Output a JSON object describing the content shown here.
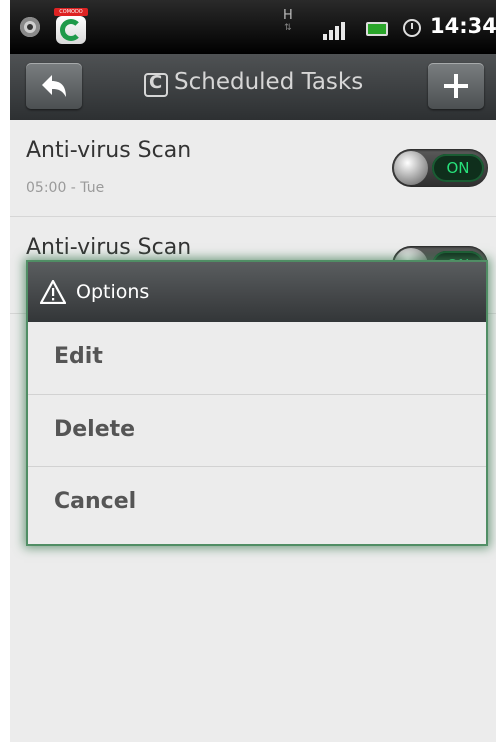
{
  "status_bar": {
    "app_badge": "COMODO",
    "network_label": "H",
    "time": "14:34"
  },
  "title_bar": {
    "title": "Scheduled Tasks"
  },
  "tasks": [
    {
      "title": "Anti-virus Scan",
      "schedule": "05:00 - Tue",
      "toggle": "ON"
    },
    {
      "title": "Anti-virus Scan",
      "schedule": "",
      "toggle": "ON"
    }
  ],
  "dialog": {
    "title": "Options",
    "items": [
      "Edit",
      "Delete",
      "Cancel"
    ]
  },
  "colors": {
    "toggle_on": "#27e07a",
    "dialog_glow": "#5e9c72",
    "header": "#3a3d3f"
  }
}
